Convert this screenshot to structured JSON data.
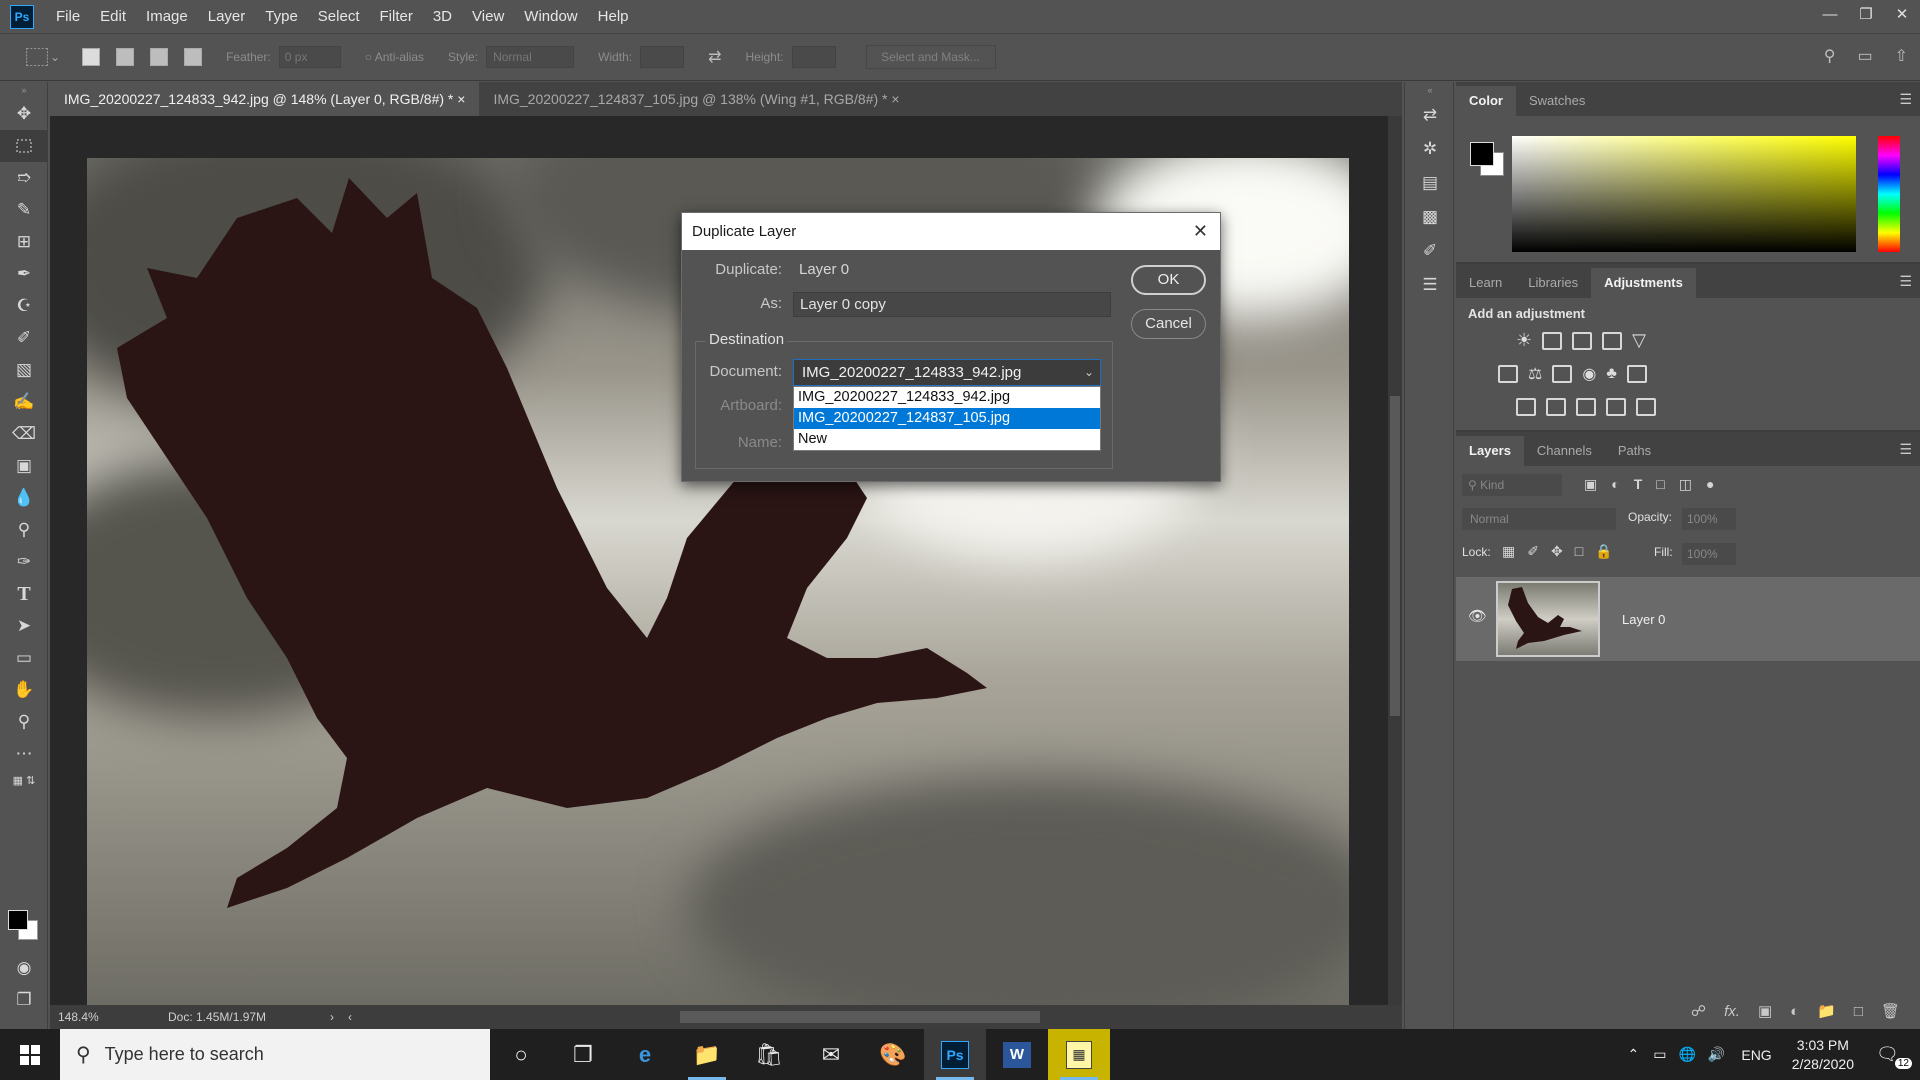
{
  "app": {
    "logo": "Ps",
    "menu": [
      "File",
      "Edit",
      "Image",
      "Layer",
      "Type",
      "Select",
      "Filter",
      "3D",
      "View",
      "Window",
      "Help"
    ]
  },
  "options_bar": {
    "feather_label": "Feather:",
    "feather_value": "0 px",
    "anti_alias_label": "Anti-alias",
    "style_label": "Style:",
    "style_value": "Normal",
    "width_label": "Width:",
    "height_label": "Height:",
    "select_mask_label": "Select and Mask..."
  },
  "doc_tabs": [
    {
      "label": "IMG_20200227_124833_942.jpg @ 148% (Layer 0, RGB/8#) *",
      "close": "×"
    },
    {
      "label": "IMG_20200227_124837_105.jpg @ 138% (Wing #1, RGB/8#) *",
      "close": "×"
    }
  ],
  "status": {
    "zoom": "148.4%",
    "doc": "Doc: 1.45M/1.97M"
  },
  "color_panel": {
    "tabs": [
      "Color",
      "Swatches"
    ]
  },
  "adjust_panel": {
    "tabs": [
      "Learn",
      "Libraries",
      "Adjustments"
    ],
    "heading": "Add an adjustment"
  },
  "layers_panel": {
    "tabs": [
      "Layers",
      "Channels",
      "Paths"
    ],
    "kind_placeholder": "Kind",
    "blend_mode": "Normal",
    "opacity_label": "Opacity:",
    "opacity_value": "100%",
    "lock_label": "Lock:",
    "fill_label": "Fill:",
    "fill_value": "100%",
    "layer_name": "Layer 0",
    "fx_label": "fx."
  },
  "dialog": {
    "title": "Duplicate Layer",
    "duplicate_label": "Duplicate:",
    "duplicate_value": "Layer 0",
    "as_label": "As:",
    "as_value": "Layer 0 copy",
    "destination_label": "Destination",
    "document_label": "Document:",
    "document_value": "IMG_20200227_124833_942.jpg",
    "artboard_label": "Artboard:",
    "name_label": "Name:",
    "ok_label": "OK",
    "cancel_label": "Cancel",
    "options": [
      "IMG_20200227_124833_942.jpg",
      "IMG_20200227_124837_105.jpg",
      "New"
    ],
    "highlighted_option": "IMG_20200227_124837_105.jpg"
  },
  "taskbar": {
    "search_placeholder": "Type here to search",
    "lang": "ENG",
    "time": "3:03 PM",
    "date": "2/28/2020",
    "notification_count": "12"
  },
  "colors": {
    "ui_bg": "#535353",
    "accent": "#31a8ff",
    "selection": "#0078d7",
    "bird": "#2a1414"
  }
}
